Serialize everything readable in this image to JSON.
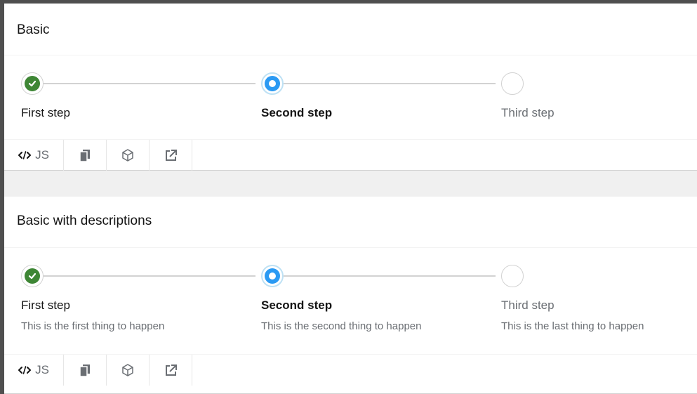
{
  "examples": [
    {
      "title": "Basic",
      "steps": [
        {
          "title": "First step",
          "status": "done"
        },
        {
          "title": "Second step",
          "status": "current"
        },
        {
          "title": "Third step",
          "status": "pending"
        }
      ],
      "toolbar": {
        "js_label": "JS",
        "icons": [
          "code-icon",
          "copy-icon",
          "codesandbox-icon",
          "external-link-icon"
        ]
      }
    },
    {
      "title": "Basic with descriptions",
      "steps": [
        {
          "title": "First step",
          "description": "This is the first thing to happen",
          "status": "done"
        },
        {
          "title": "Second step",
          "description": "This is the second thing to happen",
          "status": "current"
        },
        {
          "title": "Third step",
          "description": "This is the last thing to happen",
          "status": "pending"
        }
      ],
      "toolbar": {
        "js_label": "JS",
        "icons": [
          "code-icon",
          "copy-icon",
          "codesandbox-icon",
          "external-link-icon"
        ]
      }
    }
  ],
  "colors": {
    "success": "#3e8635",
    "current": "#2b9af3",
    "muted": "#6a6e73",
    "line": "#d2d2d2"
  }
}
